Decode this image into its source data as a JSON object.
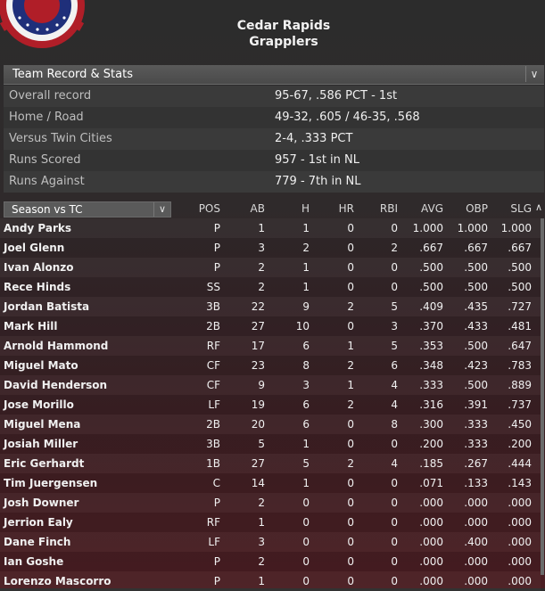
{
  "team": {
    "line1": "Cedar Rapids",
    "line2": "Grapplers"
  },
  "section": {
    "title": "Team Record & Stats",
    "chevron": "chevron-down-icon"
  },
  "record": [
    {
      "label": "Overall record",
      "value": "95-67, .586 PCT - 1st"
    },
    {
      "label": "Home / Road",
      "value": "49-32, .605 / 46-35, .568"
    },
    {
      "label": "Versus Twin Cities",
      "value": "2-4, .333 PCT"
    },
    {
      "label": "Runs Scored",
      "value": "957 - 1st in NL"
    },
    {
      "label": "Runs Against",
      "value": "779 - 7th in NL"
    }
  ],
  "filter": {
    "selected": "Season vs TC"
  },
  "columns": [
    "POS",
    "AB",
    "H",
    "HR",
    "RBI",
    "AVG",
    "OBP",
    "SLG"
  ],
  "players": [
    {
      "name": "Andy Parks",
      "pos": "P",
      "ab": "1",
      "h": "1",
      "hr": "0",
      "rbi": "0",
      "avg": "1.000",
      "obp": "1.000",
      "slg": "1.000"
    },
    {
      "name": "Joel Glenn",
      "pos": "P",
      "ab": "3",
      "h": "2",
      "hr": "0",
      "rbi": "2",
      "avg": ".667",
      "obp": ".667",
      "slg": ".667"
    },
    {
      "name": "Ivan Alonzo",
      "pos": "P",
      "ab": "2",
      "h": "1",
      "hr": "0",
      "rbi": "0",
      "avg": ".500",
      "obp": ".500",
      "slg": ".500"
    },
    {
      "name": "Rece Hinds",
      "pos": "SS",
      "ab": "2",
      "h": "1",
      "hr": "0",
      "rbi": "0",
      "avg": ".500",
      "obp": ".500",
      "slg": ".500"
    },
    {
      "name": "Jordan Batista",
      "pos": "3B",
      "ab": "22",
      "h": "9",
      "hr": "2",
      "rbi": "5",
      "avg": ".409",
      "obp": ".435",
      "slg": ".727"
    },
    {
      "name": "Mark Hill",
      "pos": "2B",
      "ab": "27",
      "h": "10",
      "hr": "0",
      "rbi": "3",
      "avg": ".370",
      "obp": ".433",
      "slg": ".481"
    },
    {
      "name": "Arnold Hammond",
      "pos": "RF",
      "ab": "17",
      "h": "6",
      "hr": "1",
      "rbi": "5",
      "avg": ".353",
      "obp": ".500",
      "slg": ".647"
    },
    {
      "name": "Miguel Mato",
      "pos": "CF",
      "ab": "23",
      "h": "8",
      "hr": "2",
      "rbi": "6",
      "avg": ".348",
      "obp": ".423",
      "slg": ".783"
    },
    {
      "name": "David Henderson",
      "pos": "CF",
      "ab": "9",
      "h": "3",
      "hr": "1",
      "rbi": "4",
      "avg": ".333",
      "obp": ".500",
      "slg": ".889"
    },
    {
      "name": "Jose Morillo",
      "pos": "LF",
      "ab": "19",
      "h": "6",
      "hr": "2",
      "rbi": "4",
      "avg": ".316",
      "obp": ".391",
      "slg": ".737"
    },
    {
      "name": "Miguel Mena",
      "pos": "2B",
      "ab": "20",
      "h": "6",
      "hr": "0",
      "rbi": "8",
      "avg": ".300",
      "obp": ".333",
      "slg": ".450"
    },
    {
      "name": "Josiah Miller",
      "pos": "3B",
      "ab": "5",
      "h": "1",
      "hr": "0",
      "rbi": "0",
      "avg": ".200",
      "obp": ".333",
      "slg": ".200"
    },
    {
      "name": "Eric Gerhardt",
      "pos": "1B",
      "ab": "27",
      "h": "5",
      "hr": "2",
      "rbi": "4",
      "avg": ".185",
      "obp": ".267",
      "slg": ".444"
    },
    {
      "name": "Tim Juergensen",
      "pos": "C",
      "ab": "14",
      "h": "1",
      "hr": "0",
      "rbi": "0",
      "avg": ".071",
      "obp": ".133",
      "slg": ".143"
    },
    {
      "name": "Josh Downer",
      "pos": "P",
      "ab": "2",
      "h": "0",
      "hr": "0",
      "rbi": "0",
      "avg": ".000",
      "obp": ".000",
      "slg": ".000"
    },
    {
      "name": "Jerrion Ealy",
      "pos": "RF",
      "ab": "1",
      "h": "0",
      "hr": "0",
      "rbi": "0",
      "avg": ".000",
      "obp": ".000",
      "slg": ".000"
    },
    {
      "name": "Dane Finch",
      "pos": "LF",
      "ab": "3",
      "h": "0",
      "hr": "0",
      "rbi": "0",
      "avg": ".000",
      "obp": ".400",
      "slg": ".000"
    },
    {
      "name": "Ian Goshe",
      "pos": "P",
      "ab": "2",
      "h": "0",
      "hr": "0",
      "rbi": "0",
      "avg": ".000",
      "obp": ".000",
      "slg": ".000"
    },
    {
      "name": "Lorenzo Mascorro",
      "pos": "P",
      "ab": "1",
      "h": "0",
      "hr": "0",
      "rbi": "0",
      "avg": ".000",
      "obp": ".000",
      "slg": ".000"
    }
  ]
}
